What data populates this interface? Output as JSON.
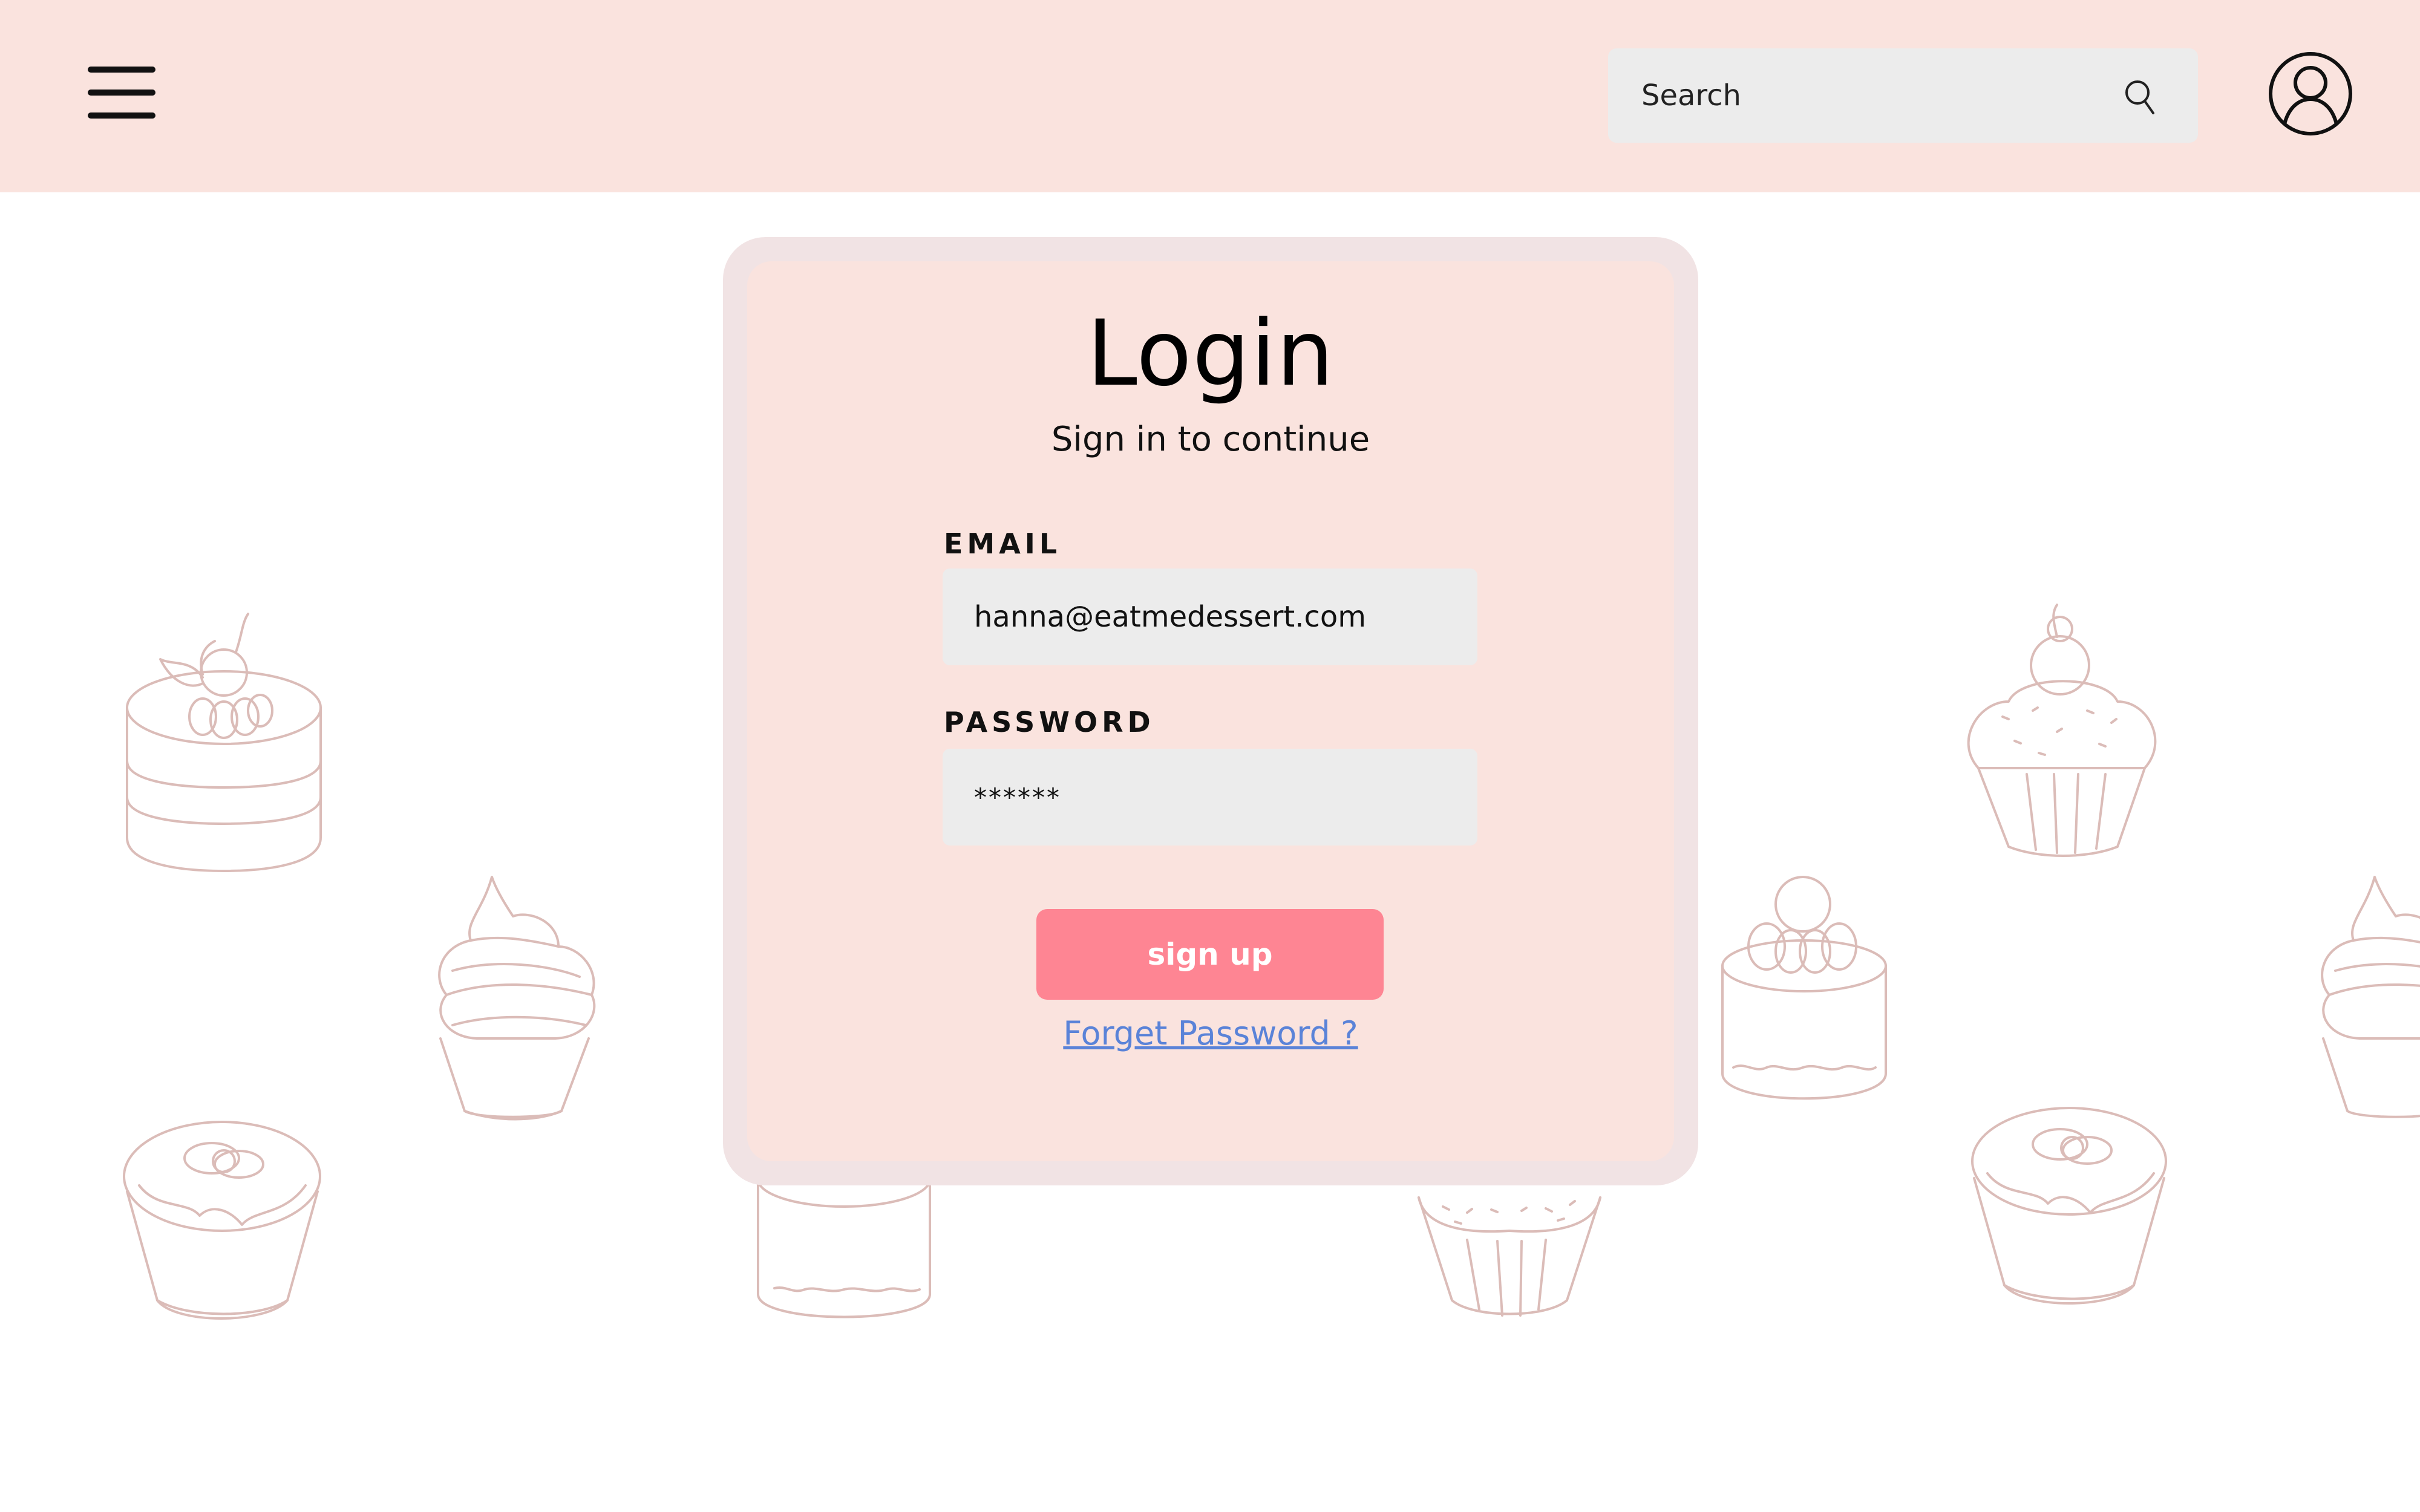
{
  "header": {
    "menu_icon": "hamburger-menu-icon",
    "search": {
      "placeholder": "Search",
      "icon": "search-icon"
    },
    "account_icon": "user-account-icon"
  },
  "login": {
    "title": "Login",
    "subtitle": "Sign in to continue",
    "email": {
      "label": "EMAIL",
      "value": "hanna@eatmedessert.com"
    },
    "password": {
      "label": "PASSWORD",
      "value": "******"
    },
    "submit_label": "sign up",
    "forgot_label": "Forget Password ?"
  },
  "background": {
    "illustration": "dessert-line-art",
    "line_color": "#dbbcb8"
  },
  "colors": {
    "header_bg": "#fae3de",
    "card_bg": "#fae3de",
    "card_border": "#f1e3e4",
    "button_bg": "#fe8593",
    "link": "#5a83d8",
    "field_bg": "#ececec"
  }
}
